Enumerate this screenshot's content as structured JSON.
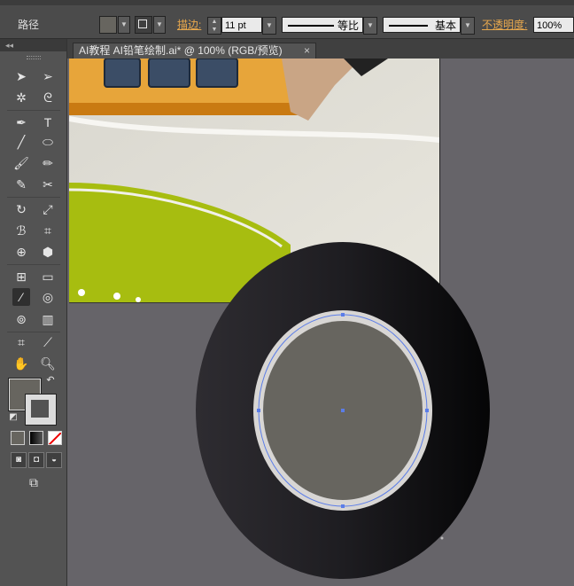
{
  "control_bar": {
    "object_type": "路径",
    "stroke_label": "描边:",
    "stroke_weight": "11 pt",
    "variable_width_profile": "等比",
    "brush_definition": "基本",
    "opacity_label": "不透明度:",
    "opacity_value": "100%"
  },
  "document_tab": {
    "title": "AI教程  AI铅笔绘制.ai* @ 100% (RGB/预览)",
    "close_glyph": "×"
  },
  "tools_panel": {
    "collapse_glyph": "◂◂"
  },
  "colors": {
    "fill": "#67655f",
    "stroke": "#dcdcdc",
    "selection": "#5b7de8",
    "accent_label": "#e8a84d"
  }
}
